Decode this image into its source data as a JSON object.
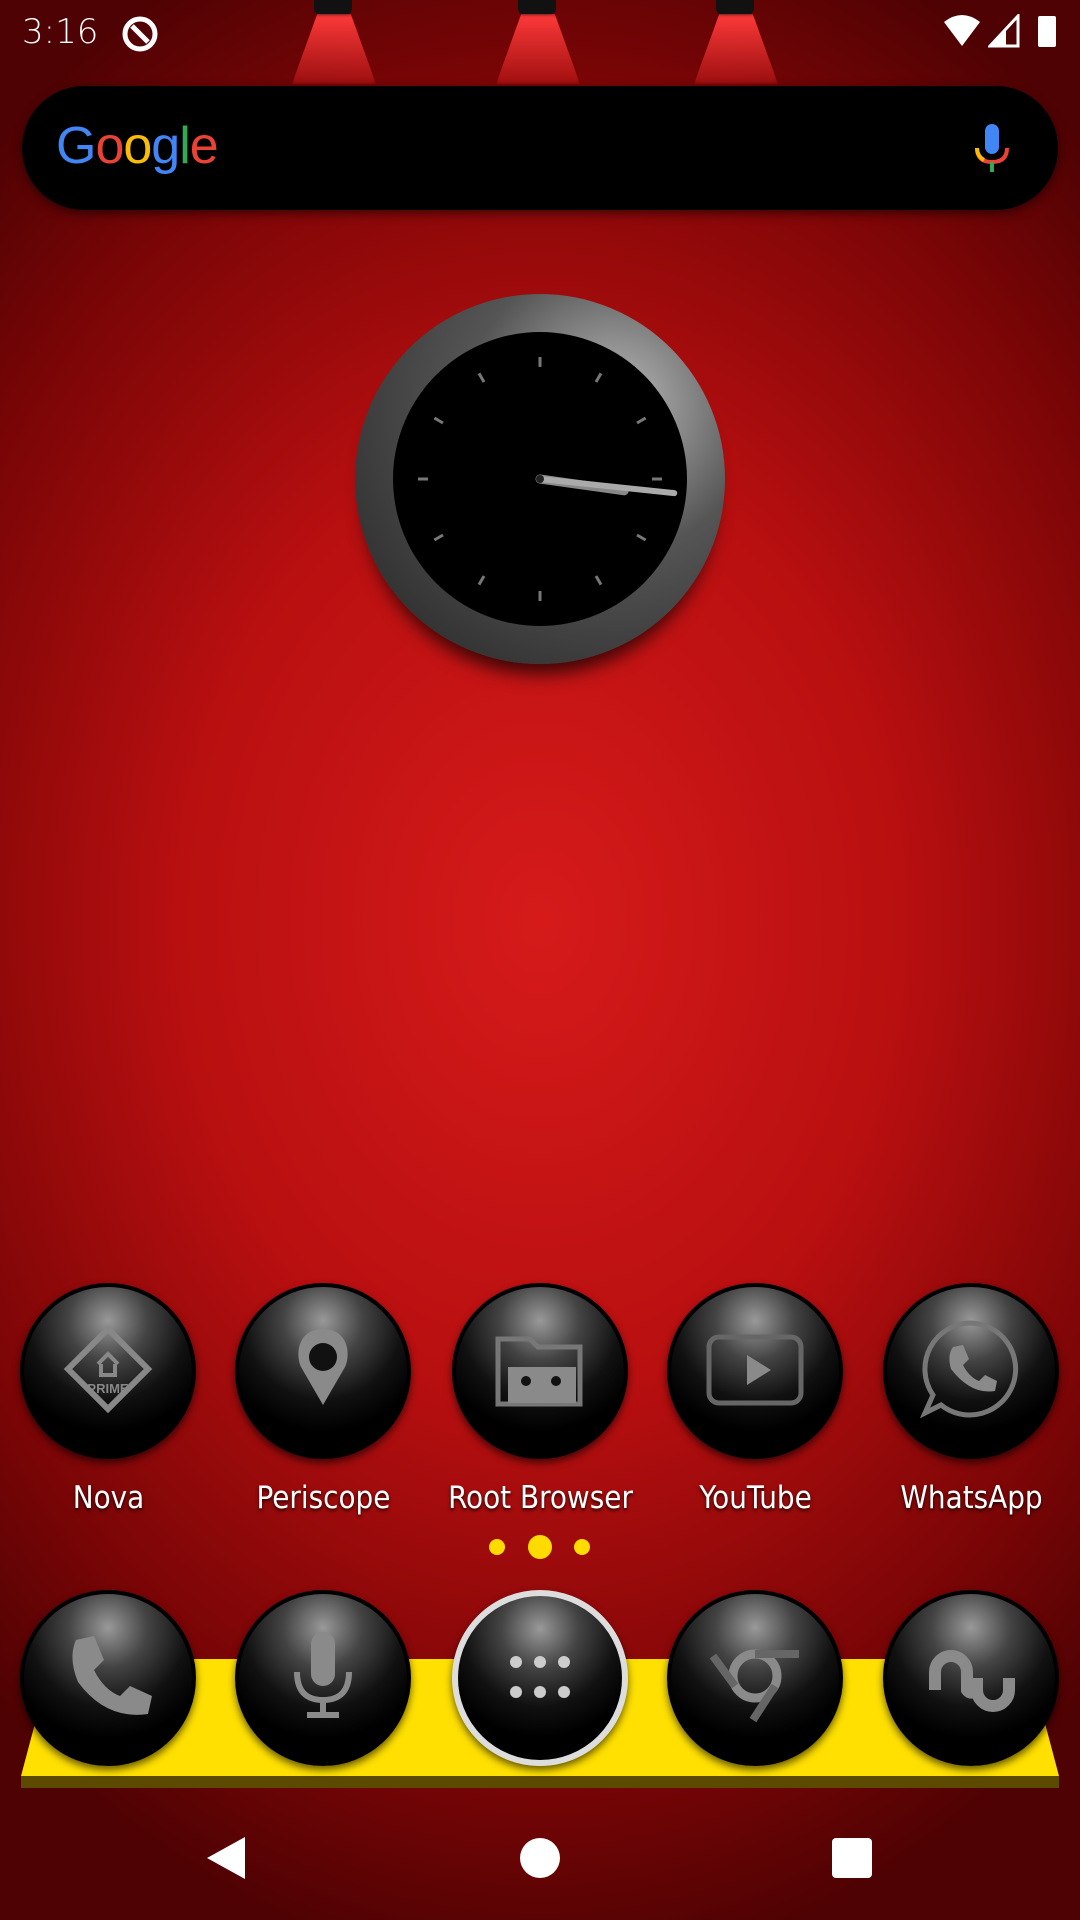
{
  "status_bar": {
    "time": "3:16",
    "icons": [
      "data-saver-icon",
      "wifi-icon",
      "signal-icon",
      "battery-icon"
    ]
  },
  "search_widget": {
    "logo": "Google",
    "mic_icon": "mic-icon",
    "colors": {
      "blue": "#4285F4",
      "red": "#EA4335",
      "yellow": "#FBBC05",
      "green": "#34A853"
    }
  },
  "clock_widget": {
    "time": "3:16"
  },
  "apps": [
    {
      "label": "Nova",
      "icon": "nova-prime-icon",
      "badge_text": "PRIME"
    },
    {
      "label": "Periscope",
      "icon": "periscope-icon"
    },
    {
      "label": "Root Browser",
      "icon": "root-browser-icon"
    },
    {
      "label": "YouTube",
      "icon": "youtube-icon"
    },
    {
      "label": "WhatsApp",
      "icon": "whatsapp-icon"
    }
  ],
  "page_indicator": {
    "pages": 3,
    "current": 2
  },
  "dock": [
    "phone-icon",
    "voice-search-icon",
    "app-drawer-icon",
    "chrome-icon",
    "stumbleupon-icon"
  ],
  "nav_bar": [
    "back-button",
    "home-button",
    "recents-button"
  ],
  "colors": {
    "accent": "#FFE000",
    "background": "#C41414"
  }
}
